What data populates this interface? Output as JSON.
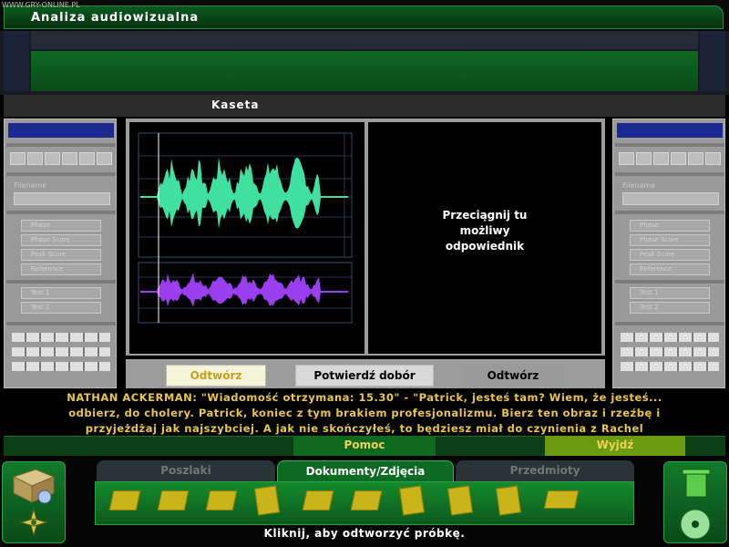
{
  "watermark": "WWW.GRY-ONLINE.PL",
  "window": {
    "title": "Analiza audiowizualna"
  },
  "section": {
    "title": "Kaseta"
  },
  "left_panel": {
    "filename_label": "Filename",
    "buttons": [
      "Phase",
      "Phase Score",
      "Peak Score",
      "Reference",
      "Test 1",
      "Test 2"
    ]
  },
  "right_panel": {
    "filename_label": "Filename",
    "buttons": [
      "Phase",
      "Phase Score",
      "Peak Score",
      "Reference",
      "Test 1",
      "Test 2"
    ]
  },
  "drop_zone": {
    "text_lines": [
      "Przeciągnij tu",
      "możliwy",
      "odpowiednik"
    ]
  },
  "controls": {
    "play_left": "Odtwórz",
    "confirm": "Potwierdź dobór",
    "play_right": "Odtwórz"
  },
  "dialog": {
    "lines": [
      "NATHAN ACKERMAN:  \"Wiadomość otrzymana: 15.30\" - \"Patrick, jesteś tam? Wiem, że jesteś...",
      "odbierz, do cholery. Patrick, koniec z tym brakiem profesjonalizmu. Bierz ten obraz i rzeźbę i",
      "przyjeżdżaj jak najszybciej. A jak nie skończyłeś, to będziesz miał do czynienia z Rachel"
    ]
  },
  "bottom_buttons": {
    "help": "Pomoc",
    "exit": "Wyjdź"
  },
  "inventory": {
    "tabs": [
      "Poszlaki",
      "Dokumenty/Zdjęcia",
      "Przedmioty"
    ],
    "active_tab": "Dokumenty/Zdjęcia",
    "item_count_icons": [
      "document-icon",
      "document-icon",
      "document-icon",
      "document-icon",
      "document-icon",
      "photo-icon",
      "document-icon",
      "document-icon",
      "document-icon",
      "book-icon"
    ]
  },
  "status": "Kliknij, aby odtworzyć próbkę.",
  "colors": {
    "dialog_text": "#e8c64a",
    "wave_top": "#3fe0a0",
    "wave_bottom": "#9a3ff0",
    "accent_green": "#0d6a22"
  }
}
